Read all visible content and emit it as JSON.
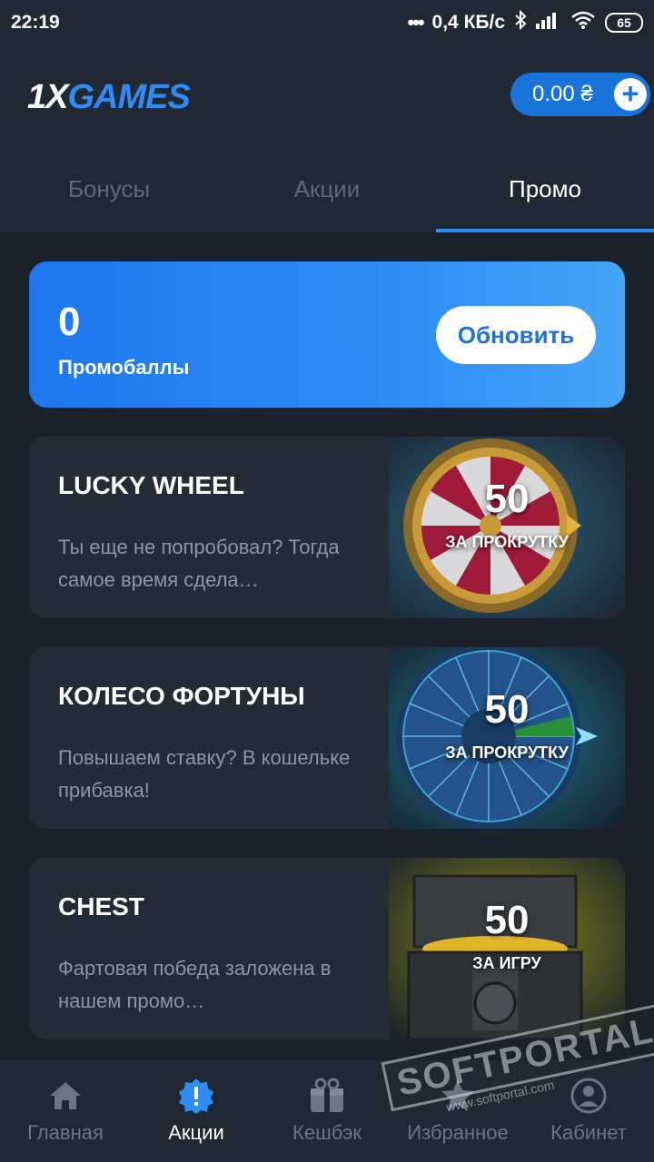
{
  "status_bar": {
    "time": "22:19",
    "network": "0,4 КБ/с",
    "battery": "65"
  },
  "header": {
    "logo_one": "1X",
    "logo_games": "GAMES",
    "balance": "0.00 ₴"
  },
  "tabs": [
    {
      "label": "Бонусы",
      "active": false
    },
    {
      "label": "Акции",
      "active": false
    },
    {
      "label": "Промо",
      "active": true
    }
  ],
  "points_card": {
    "value": "0",
    "label": "Промобаллы",
    "refresh_label": "Обновить"
  },
  "games": [
    {
      "title": "LUCKY WHEEL",
      "desc": "Ты еще не попробовал? Тогда самое время сдела…",
      "cost": "50",
      "cost_unit": "ЗА ПРОКРУТКУ",
      "icon": "lucky-wheel-art"
    },
    {
      "title": "КОЛЕСО ФОРТУНЫ",
      "desc": "Повышаем ставку? В кошельке прибавка!",
      "cost": "50",
      "cost_unit": "ЗА ПРОКРУТКУ",
      "icon": "fortune-wheel-art"
    },
    {
      "title": "CHEST",
      "desc": "Фартовая победа заложена в нашем промо…",
      "cost": "50",
      "cost_unit": "ЗА ИГРУ",
      "icon": "chest-art"
    }
  ],
  "bottom_nav": [
    {
      "label": "Главная",
      "icon": "home-icon",
      "active": false
    },
    {
      "label": "Акции",
      "icon": "promo-alert-icon",
      "active": true
    },
    {
      "label": "Кешбэк",
      "icon": "gift-box-icon",
      "active": false
    },
    {
      "label": "Избранное",
      "icon": "star-icon",
      "active": false
    },
    {
      "label": "Кабинет",
      "icon": "user-icon",
      "active": false
    }
  ],
  "watermark": {
    "brand": "SOFTPORTAL",
    "url": "www.softportal.com"
  },
  "colors": {
    "accent": "#2f8cf5",
    "background": "#1b222c",
    "panel": "#202833",
    "card": "#232b37"
  }
}
